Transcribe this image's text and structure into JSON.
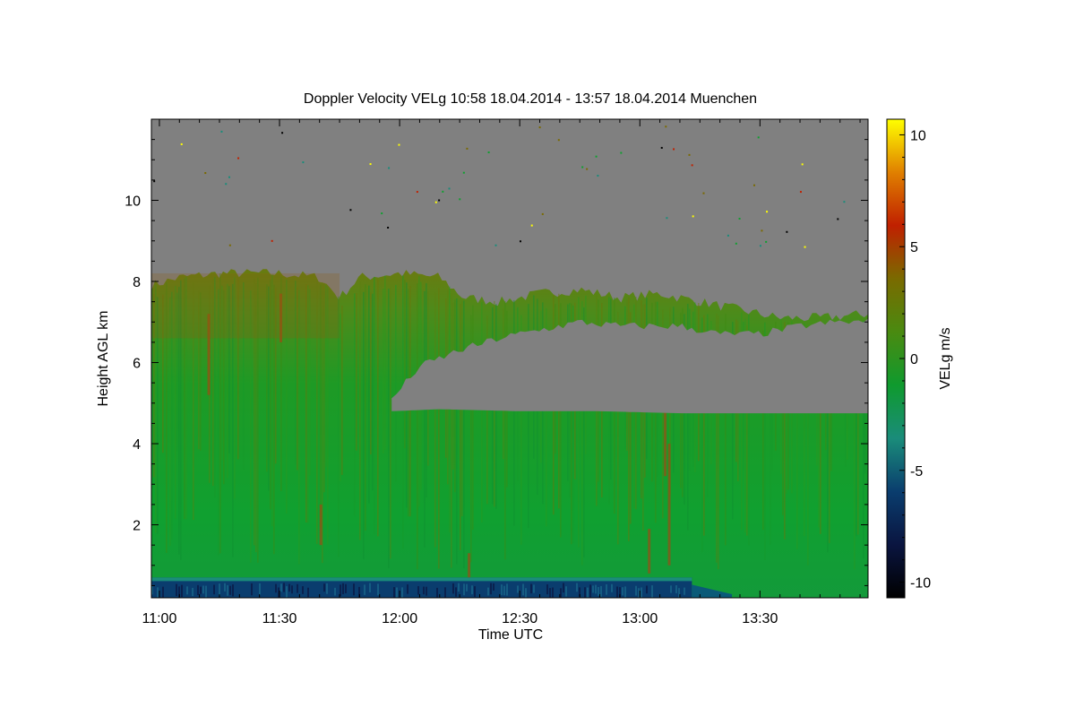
{
  "chart_data": {
    "type": "heatmap",
    "title": "Doppler Velocity VELg   10:58 18.04.2014 - 13:57 18.04.2014 Muenchen",
    "xlabel": "Time UTC",
    "ylabel": "Height AGL km",
    "colorbar_label": "VELg m/s",
    "x_range_minutes": [
      658,
      837
    ],
    "y_range_km": [
      0.2,
      12.0
    ],
    "color_range": [
      -10.7,
      10.7
    ],
    "x_ticks": [
      {
        "minute": 660,
        "label": "11:00"
      },
      {
        "minute": 690,
        "label": "11:30"
      },
      {
        "minute": 720,
        "label": "12:00"
      },
      {
        "minute": 750,
        "label": "12:30"
      },
      {
        "minute": 780,
        "label": "13:00"
      },
      {
        "minute": 810,
        "label": "13:30"
      }
    ],
    "y_ticks": [
      {
        "value": 2,
        "label": "2"
      },
      {
        "value": 4,
        "label": "4"
      },
      {
        "value": 6,
        "label": "6"
      },
      {
        "value": 8,
        "label": "8"
      },
      {
        "value": 10,
        "label": "10"
      }
    ],
    "colorbar_ticks": [
      {
        "value": 10,
        "label": "10"
      },
      {
        "value": 5,
        "label": "5"
      },
      {
        "value": 0,
        "label": "0"
      },
      {
        "value": -5,
        "label": "-5"
      },
      {
        "value": -10,
        "label": "-10"
      }
    ],
    "colors": {
      "no_data": "#808080",
      "scale": [
        "#000000",
        "#0a1540",
        "#0a3d6e",
        "#1a8c7a",
        "#0f9a2e",
        "#4a8a10",
        "#7a6a00",
        "#c02000",
        "#e08000",
        "#ffff00"
      ]
    },
    "cloud_top_km": [
      [
        658,
        7.9
      ],
      [
        665,
        8.1
      ],
      [
        675,
        8.2
      ],
      [
        690,
        8.2
      ],
      [
        700,
        8.1
      ],
      [
        705,
        7.6
      ],
      [
        710,
        8.1
      ],
      [
        720,
        8.2
      ],
      [
        730,
        8.1
      ],
      [
        736,
        7.6
      ],
      [
        745,
        7.5
      ],
      [
        755,
        7.7
      ],
      [
        765,
        7.8
      ],
      [
        775,
        7.6
      ],
      [
        785,
        7.7
      ],
      [
        795,
        7.5
      ],
      [
        805,
        7.3
      ],
      [
        815,
        7.1
      ],
      [
        825,
        7.1
      ],
      [
        837,
        7.2
      ]
    ],
    "clear_gap": {
      "top_km": [
        [
          718,
          5.1
        ],
        [
          725,
          5.9
        ],
        [
          735,
          6.3
        ],
        [
          745,
          6.6
        ],
        [
          755,
          6.8
        ],
        [
          765,
          7.0
        ],
        [
          775,
          6.9
        ],
        [
          790,
          6.9
        ],
        [
          800,
          6.7
        ],
        [
          810,
          6.7
        ],
        [
          820,
          6.9
        ],
        [
          830,
          7.0
        ],
        [
          837,
          7.0
        ]
      ],
      "bottom_km": [
        [
          718,
          4.8
        ],
        [
          730,
          4.85
        ],
        [
          750,
          4.8
        ],
        [
          770,
          4.8
        ],
        [
          790,
          4.75
        ],
        [
          810,
          4.75
        ],
        [
          837,
          4.75
        ]
      ]
    },
    "low_layer_top_km": 0.7,
    "low_layer_end_minute": 793
  }
}
